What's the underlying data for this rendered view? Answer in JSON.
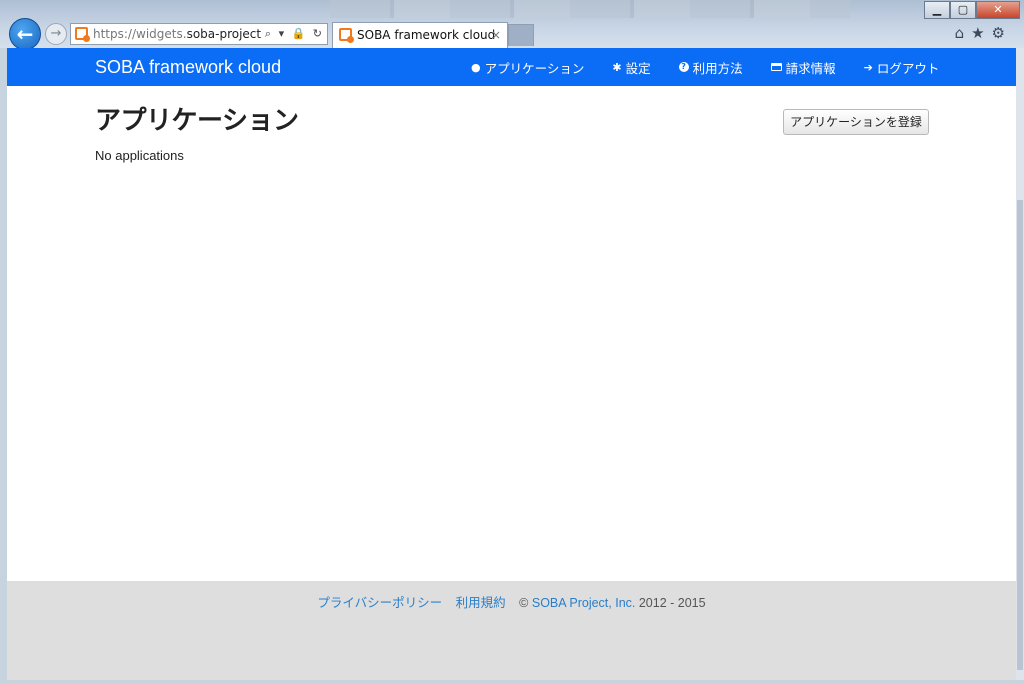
{
  "browser": {
    "url_scheme": "https://widgets.",
    "url_host": "soba-project.c...",
    "tab_title": "SOBA framework cloud",
    "tab_close": "×",
    "back_glyph": "←",
    "forward_glyph": "→",
    "url_tools": "⌕ ▾ 🔒 ↻",
    "window_min": "▁",
    "window_max": "▢",
    "window_close": "✕",
    "toolbar_icons": "⌂★⚙"
  },
  "navbar": {
    "brand": "SOBA framework cloud",
    "items": [
      {
        "icon": "globe-icon",
        "label": "アプリケーション"
      },
      {
        "icon": "gear-icon",
        "label": "設定"
      },
      {
        "icon": "help-icon",
        "label": "利用方法"
      },
      {
        "icon": "credit-card-icon",
        "label": "請求情報"
      },
      {
        "icon": "arrow-right-icon",
        "label": "ログアウト"
      }
    ],
    "color": "#0b6cf5"
  },
  "main": {
    "title": "アプリケーション",
    "register_button": "アプリケーションを登録",
    "empty_message": "No applications"
  },
  "footer": {
    "privacy_link": "プライバシーポリシー",
    "terms_link": "利用規約",
    "copyright_symbol": "©",
    "company_link": "SOBA Project, Inc.",
    "years": "2012 - 2015"
  }
}
